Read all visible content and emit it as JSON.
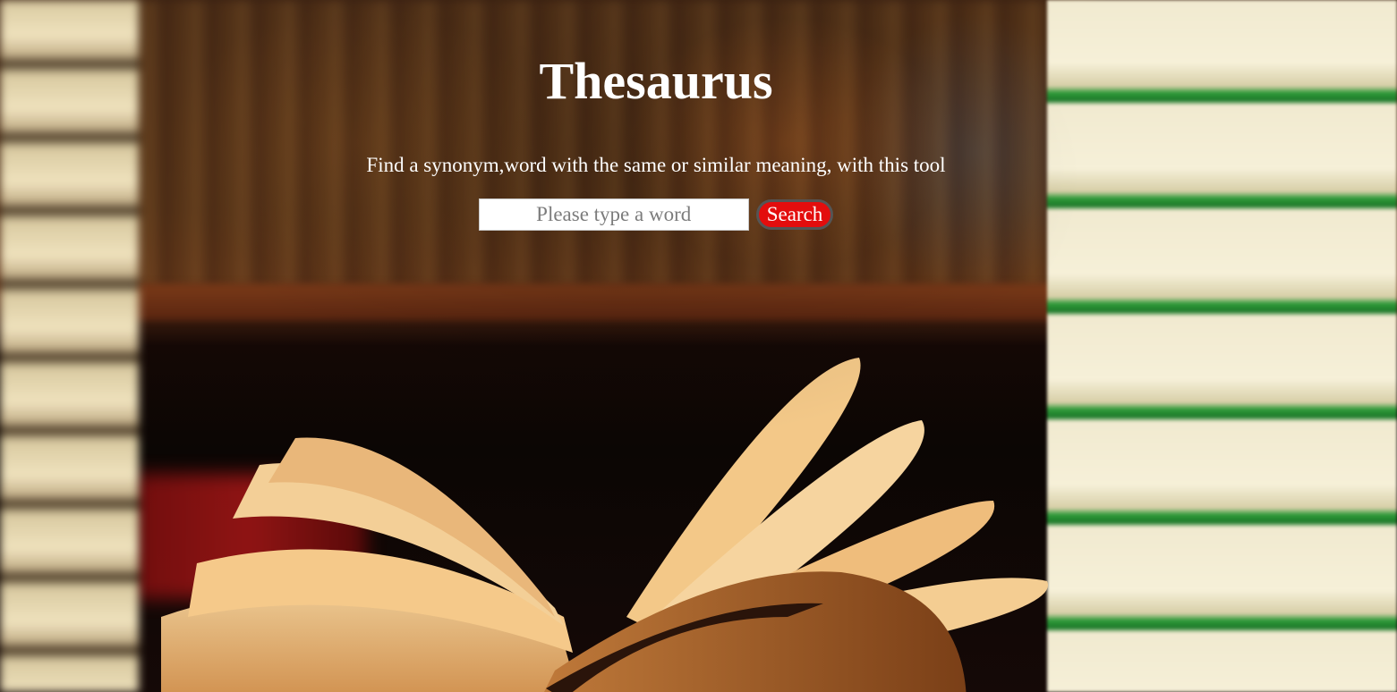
{
  "header": {
    "title": "Thesaurus",
    "tagline": "Find a synonym,word with the same or similar meaning, with this tool"
  },
  "search": {
    "placeholder": "Please type a word",
    "value": "",
    "button_label": "Search"
  },
  "colors": {
    "button_background": "#e30d0d",
    "button_border": "#555555",
    "text": "#ffffff"
  }
}
